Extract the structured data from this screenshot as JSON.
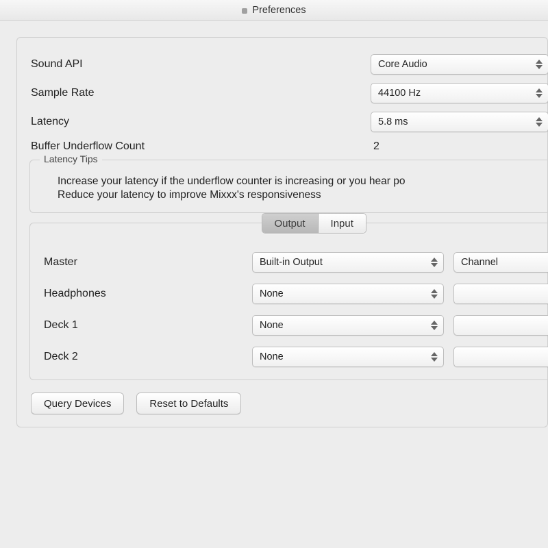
{
  "window": {
    "title": "Preferences"
  },
  "fields": {
    "sound_api": {
      "label": "Sound API",
      "value": "Core Audio"
    },
    "sample_rate": {
      "label": "Sample Rate",
      "value": "44100 Hz"
    },
    "latency": {
      "label": "Latency",
      "value": "5.8 ms"
    },
    "underflow": {
      "label": "Buffer Underflow Count",
      "value": "2"
    }
  },
  "tips": {
    "legend": "Latency Tips",
    "items": [
      "Increase your latency if the underflow counter is increasing or you hear po",
      "Reduce your latency to improve Mixxx's responsiveness"
    ]
  },
  "io": {
    "tabs": {
      "output": "Output",
      "input": "Input",
      "active": "output"
    },
    "rows": {
      "master": {
        "label": "Master",
        "device": "Built-in Output",
        "channel": "Channel"
      },
      "headphones": {
        "label": "Headphones",
        "device": "None",
        "channel": ""
      },
      "deck1": {
        "label": "Deck 1",
        "device": "None",
        "channel": ""
      },
      "deck2": {
        "label": "Deck 2",
        "device": "None",
        "channel": ""
      }
    }
  },
  "buttons": {
    "query": "Query Devices",
    "reset": "Reset to Defaults"
  }
}
